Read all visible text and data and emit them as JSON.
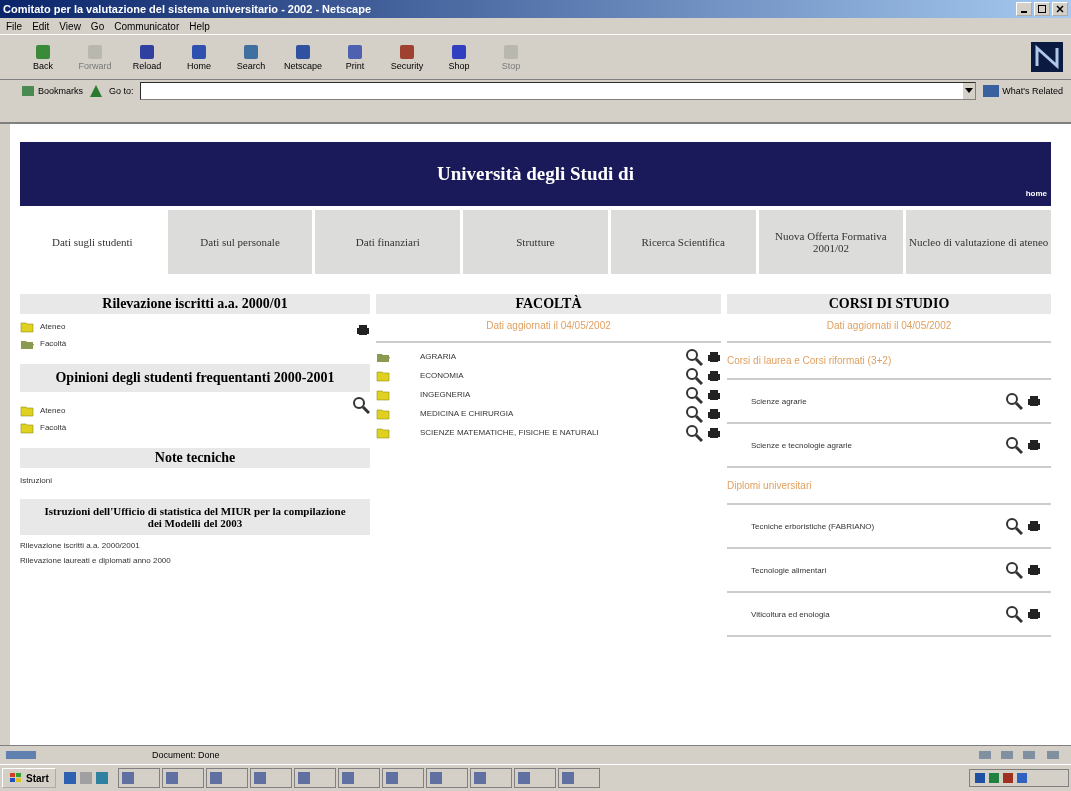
{
  "window": {
    "title": "Comitato per la valutazione del sistema universitario - 2002 - Netscape"
  },
  "menu": [
    "File",
    "Edit",
    "View",
    "Go",
    "Communicator",
    "Help"
  ],
  "toolbar": [
    {
      "label": "Back",
      "disabled": false
    },
    {
      "label": "Forward",
      "disabled": true
    },
    {
      "label": "Reload",
      "disabled": false
    },
    {
      "label": "Home",
      "disabled": false
    },
    {
      "label": "Search",
      "disabled": false
    },
    {
      "label": "Netscape",
      "disabled": false
    },
    {
      "label": "Print",
      "disabled": false
    },
    {
      "label": "Security",
      "disabled": false
    },
    {
      "label": "Shop",
      "disabled": false
    },
    {
      "label": "Stop",
      "disabled": true
    }
  ],
  "location": {
    "bookmarks": "Bookmarks",
    "goto": "Go to:",
    "related": "What's Related"
  },
  "header": {
    "title": "Università degli Studi di",
    "home": "home"
  },
  "tabs": [
    {
      "label": "Dati sugli studenti",
      "selected": true
    },
    {
      "label": "Dati sul personale",
      "selected": false
    },
    {
      "label": "Dati finanziari",
      "selected": false
    },
    {
      "label": "Strutture",
      "selected": false
    },
    {
      "label": "Ricerca Scientifica",
      "selected": false
    },
    {
      "label": "Nuova Offerta Formativa 2001/02",
      "selected": false
    },
    {
      "label": "Nucleo di valutazione di ateneo",
      "selected": false
    }
  ],
  "left": {
    "iscritti": {
      "title": "Rilevazione iscritti a.a. 2000/01",
      "items": [
        {
          "label": "Ateneo",
          "expanded": false
        },
        {
          "label": "Facoltà",
          "expanded": true
        }
      ]
    },
    "opinioni": {
      "title": "Opinioni degli studenti frequentanti 2000-2001",
      "items": [
        {
          "label": "Ateneo",
          "expanded": false
        },
        {
          "label": "Facoltà",
          "expanded": false
        }
      ]
    },
    "note": {
      "title": "Note tecniche",
      "istruzioni": "Istruzioni",
      "miur_title": "Istruzioni dell'Ufficio di statistica del MIUR per la compilazione dei Modelli del 2003",
      "links": [
        "Rilevazione iscritti a.a. 2000/2001",
        "Rilevazione laureati e diplomati anno 2000"
      ]
    }
  },
  "facolta": {
    "title": "FACOLTÀ",
    "updated": "Dati aggiornati il 04/05/2002",
    "items": [
      {
        "label": "AGRARIA",
        "expanded": true
      },
      {
        "label": "ECONOMIA",
        "expanded": false
      },
      {
        "label": "INGEGNERIA",
        "expanded": false
      },
      {
        "label": "MEDICINA E CHIRURGIA",
        "expanded": false
      },
      {
        "label": "SCIENZE MATEMATICHE, FISICHE E NATURALI",
        "expanded": false
      }
    ]
  },
  "corsi": {
    "title": "CORSI DI STUDIO",
    "updated": "Dati aggiornati il 04/05/2002",
    "groups": [
      {
        "title": "Corsi di laurea e Corsi riformati (3+2)",
        "items": [
          "Scienze agrarie",
          "Scienze e tecnologie agrarie"
        ]
      },
      {
        "title": "Diplomi universitari",
        "items": [
          "Tecniche erboristiche (FABRIANO)",
          "Tecnologie alimentari",
          "Viticoltura ed enologia"
        ]
      }
    ]
  },
  "status_bar": {
    "text": "Document: Done"
  },
  "taskbar": {
    "start": "Start"
  }
}
